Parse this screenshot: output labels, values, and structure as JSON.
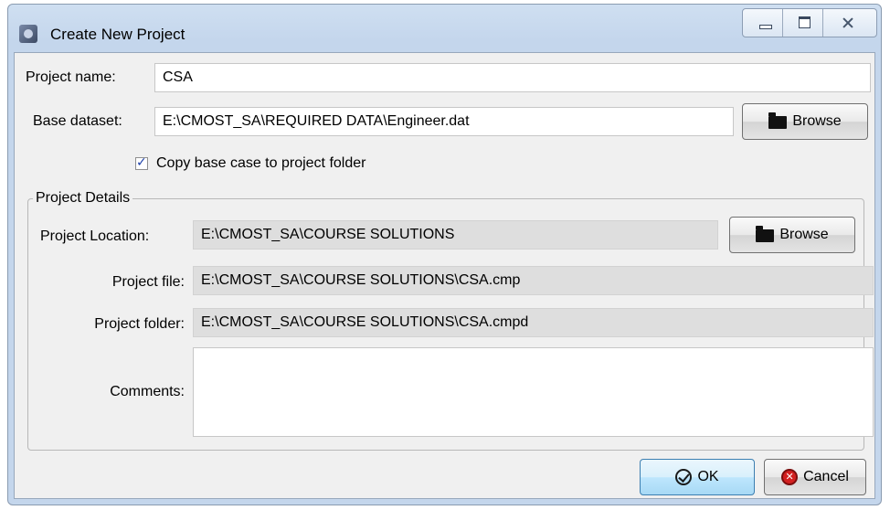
{
  "window": {
    "title": "Create New Project",
    "app_icon": "cmost-app-icon",
    "controls": [
      "minimize-icon",
      "maximize-icon",
      "close-icon"
    ]
  },
  "form": {
    "project_name_label": "Project name:",
    "project_name_value": "CSA",
    "base_dataset_label": "Base dataset:",
    "base_dataset_value": "E:\\CMOST_SA\\REQUIRED DATA\\Engineer.dat",
    "browse_label": "Browse",
    "copy_checkbox_label": "Copy base case to project folder",
    "copy_checkbox_checked": true
  },
  "details": {
    "group_title": "Project Details",
    "location_label": "Project Location:",
    "location_value": "E:\\CMOST_SA\\COURSE SOLUTIONS",
    "browse_label": "Browse",
    "file_label": "Project file:",
    "file_value": "E:\\CMOST_SA\\COURSE SOLUTIONS\\CSA.cmp",
    "folder_label": "Project folder:",
    "folder_value": "E:\\CMOST_SA\\COURSE SOLUTIONS\\CSA.cmpd",
    "comments_label": "Comments:",
    "comments_value": ""
  },
  "footer": {
    "ok_label": "OK",
    "cancel_label": "Cancel"
  },
  "colors": {
    "titlebar": "#c4d6ec",
    "client_bg": "#f0f0f0",
    "ok_accent": "#a7d9f5",
    "cancel_icon": "#d32020"
  }
}
